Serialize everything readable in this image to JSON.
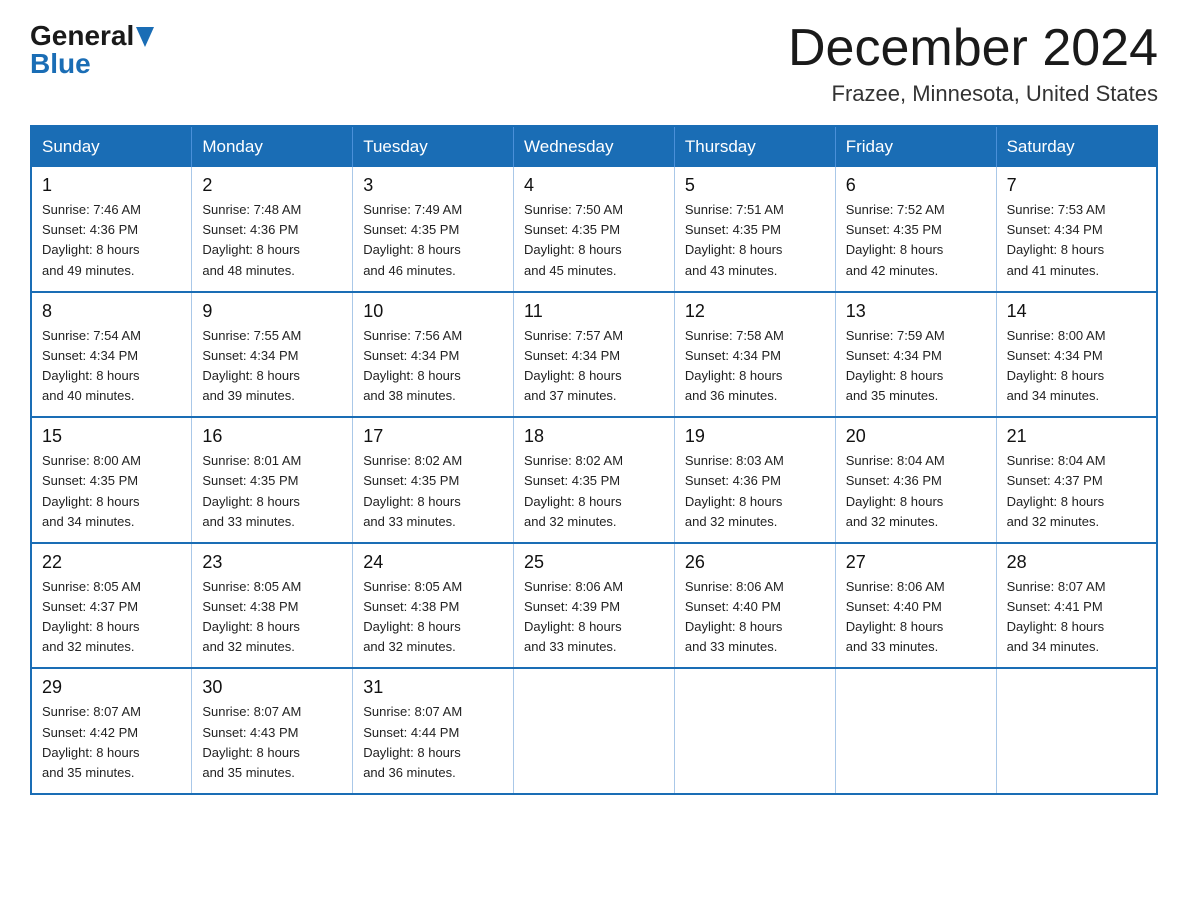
{
  "header": {
    "logo_general": "General",
    "logo_blue": "Blue",
    "month_title": "December 2024",
    "location": "Frazee, Minnesota, United States"
  },
  "days_of_week": [
    "Sunday",
    "Monday",
    "Tuesday",
    "Wednesday",
    "Thursday",
    "Friday",
    "Saturday"
  ],
  "weeks": [
    [
      {
        "day": "1",
        "sunrise": "7:46 AM",
        "sunset": "4:36 PM",
        "daylight": "8 hours and 49 minutes."
      },
      {
        "day": "2",
        "sunrise": "7:48 AM",
        "sunset": "4:36 PM",
        "daylight": "8 hours and 48 minutes."
      },
      {
        "day": "3",
        "sunrise": "7:49 AM",
        "sunset": "4:35 PM",
        "daylight": "8 hours and 46 minutes."
      },
      {
        "day": "4",
        "sunrise": "7:50 AM",
        "sunset": "4:35 PM",
        "daylight": "8 hours and 45 minutes."
      },
      {
        "day": "5",
        "sunrise": "7:51 AM",
        "sunset": "4:35 PM",
        "daylight": "8 hours and 43 minutes."
      },
      {
        "day": "6",
        "sunrise": "7:52 AM",
        "sunset": "4:35 PM",
        "daylight": "8 hours and 42 minutes."
      },
      {
        "day": "7",
        "sunrise": "7:53 AM",
        "sunset": "4:34 PM",
        "daylight": "8 hours and 41 minutes."
      }
    ],
    [
      {
        "day": "8",
        "sunrise": "7:54 AM",
        "sunset": "4:34 PM",
        "daylight": "8 hours and 40 minutes."
      },
      {
        "day": "9",
        "sunrise": "7:55 AM",
        "sunset": "4:34 PM",
        "daylight": "8 hours and 39 minutes."
      },
      {
        "day": "10",
        "sunrise": "7:56 AM",
        "sunset": "4:34 PM",
        "daylight": "8 hours and 38 minutes."
      },
      {
        "day": "11",
        "sunrise": "7:57 AM",
        "sunset": "4:34 PM",
        "daylight": "8 hours and 37 minutes."
      },
      {
        "day": "12",
        "sunrise": "7:58 AM",
        "sunset": "4:34 PM",
        "daylight": "8 hours and 36 minutes."
      },
      {
        "day": "13",
        "sunrise": "7:59 AM",
        "sunset": "4:34 PM",
        "daylight": "8 hours and 35 minutes."
      },
      {
        "day": "14",
        "sunrise": "8:00 AM",
        "sunset": "4:34 PM",
        "daylight": "8 hours and 34 minutes."
      }
    ],
    [
      {
        "day": "15",
        "sunrise": "8:00 AM",
        "sunset": "4:35 PM",
        "daylight": "8 hours and 34 minutes."
      },
      {
        "day": "16",
        "sunrise": "8:01 AM",
        "sunset": "4:35 PM",
        "daylight": "8 hours and 33 minutes."
      },
      {
        "day": "17",
        "sunrise": "8:02 AM",
        "sunset": "4:35 PM",
        "daylight": "8 hours and 33 minutes."
      },
      {
        "day": "18",
        "sunrise": "8:02 AM",
        "sunset": "4:35 PM",
        "daylight": "8 hours and 32 minutes."
      },
      {
        "day": "19",
        "sunrise": "8:03 AM",
        "sunset": "4:36 PM",
        "daylight": "8 hours and 32 minutes."
      },
      {
        "day": "20",
        "sunrise": "8:04 AM",
        "sunset": "4:36 PM",
        "daylight": "8 hours and 32 minutes."
      },
      {
        "day": "21",
        "sunrise": "8:04 AM",
        "sunset": "4:37 PM",
        "daylight": "8 hours and 32 minutes."
      }
    ],
    [
      {
        "day": "22",
        "sunrise": "8:05 AM",
        "sunset": "4:37 PM",
        "daylight": "8 hours and 32 minutes."
      },
      {
        "day": "23",
        "sunrise": "8:05 AM",
        "sunset": "4:38 PM",
        "daylight": "8 hours and 32 minutes."
      },
      {
        "day": "24",
        "sunrise": "8:05 AM",
        "sunset": "4:38 PM",
        "daylight": "8 hours and 32 minutes."
      },
      {
        "day": "25",
        "sunrise": "8:06 AM",
        "sunset": "4:39 PM",
        "daylight": "8 hours and 33 minutes."
      },
      {
        "day": "26",
        "sunrise": "8:06 AM",
        "sunset": "4:40 PM",
        "daylight": "8 hours and 33 minutes."
      },
      {
        "day": "27",
        "sunrise": "8:06 AM",
        "sunset": "4:40 PM",
        "daylight": "8 hours and 33 minutes."
      },
      {
        "day": "28",
        "sunrise": "8:07 AM",
        "sunset": "4:41 PM",
        "daylight": "8 hours and 34 minutes."
      }
    ],
    [
      {
        "day": "29",
        "sunrise": "8:07 AM",
        "sunset": "4:42 PM",
        "daylight": "8 hours and 35 minutes."
      },
      {
        "day": "30",
        "sunrise": "8:07 AM",
        "sunset": "4:43 PM",
        "daylight": "8 hours and 35 minutes."
      },
      {
        "day": "31",
        "sunrise": "8:07 AM",
        "sunset": "4:44 PM",
        "daylight": "8 hours and 36 minutes."
      },
      null,
      null,
      null,
      null
    ]
  ],
  "labels": {
    "sunrise": "Sunrise:",
    "sunset": "Sunset:",
    "daylight": "Daylight:"
  }
}
